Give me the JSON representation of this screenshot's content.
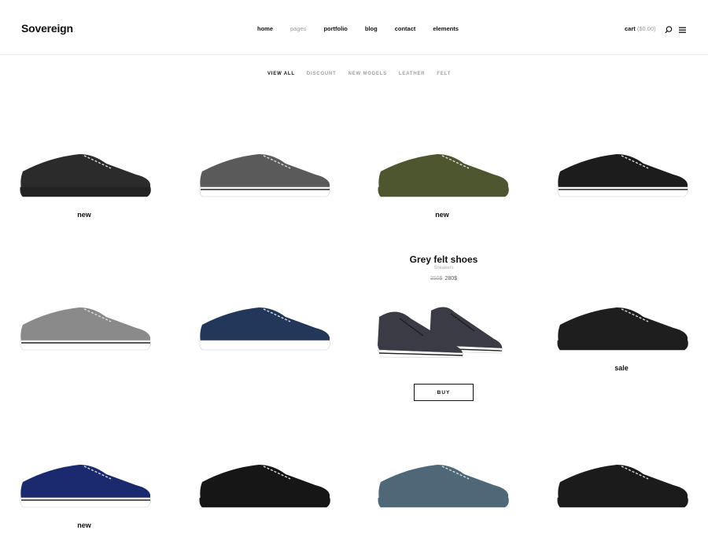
{
  "brand": {
    "logo": "Sovereign"
  },
  "nav": [
    {
      "label": "home"
    },
    {
      "label": "pages"
    },
    {
      "label": "portfolio"
    },
    {
      "label": "blog"
    },
    {
      "label": "contact"
    },
    {
      "label": "elements"
    }
  ],
  "header": {
    "cart_label": "cart",
    "cart_amount": "($0.00)",
    "search_icon": "search-icon",
    "menu_icon": "hamburger-menu-icon"
  },
  "filters": [
    {
      "label": "VIEW ALL"
    },
    {
      "label": "DISCOUNT"
    },
    {
      "label": "NEW MODELS"
    },
    {
      "label": "LEATHER"
    },
    {
      "label": "FELT"
    }
  ],
  "products": [
    {
      "color": "#2b2b2b",
      "sole": "#222222",
      "stripe": "",
      "tag": "new"
    },
    {
      "color": "#5a5a5a",
      "sole": "#ffffff",
      "stripe": "#222222",
      "tag": ""
    },
    {
      "color": "#4e5630",
      "sole": "#4e5630",
      "stripe": "",
      "tag": "new"
    },
    {
      "color": "#1c1c1c",
      "sole": "#ffffff",
      "stripe": "#222222",
      "tag": ""
    },
    {
      "color": "#8a8a8a",
      "sole": "#ffffff",
      "stripe": "#222222",
      "tag": ""
    },
    {
      "color": "#22375a",
      "sole": "#ffffff",
      "stripe": "",
      "tag": ""
    },
    {
      "color": "#3b3b45",
      "sole": "#ffffff",
      "stripe": "#222222",
      "tag": ""
    },
    {
      "color": "#1e1e1e",
      "sole": "#1e1e1e",
      "stripe": "",
      "tag": "sale"
    },
    {
      "color": "#1a2a6e",
      "sole": "#ffffff",
      "stripe": "#222222",
      "tag": "new"
    },
    {
      "color": "#161616",
      "sole": "#161616",
      "stripe": "",
      "tag": ""
    },
    {
      "color": "#4e6878",
      "sole": "#4e6878",
      "stripe": "",
      "tag": ""
    },
    {
      "color": "#1b1b1b",
      "sole": "#1b1b1b",
      "stripe": "",
      "tag": ""
    }
  ],
  "featured": {
    "title": "Grey felt shoes",
    "category": "Sneakers",
    "old_price": "350$",
    "price": "280$",
    "buy_label": "BUY"
  }
}
